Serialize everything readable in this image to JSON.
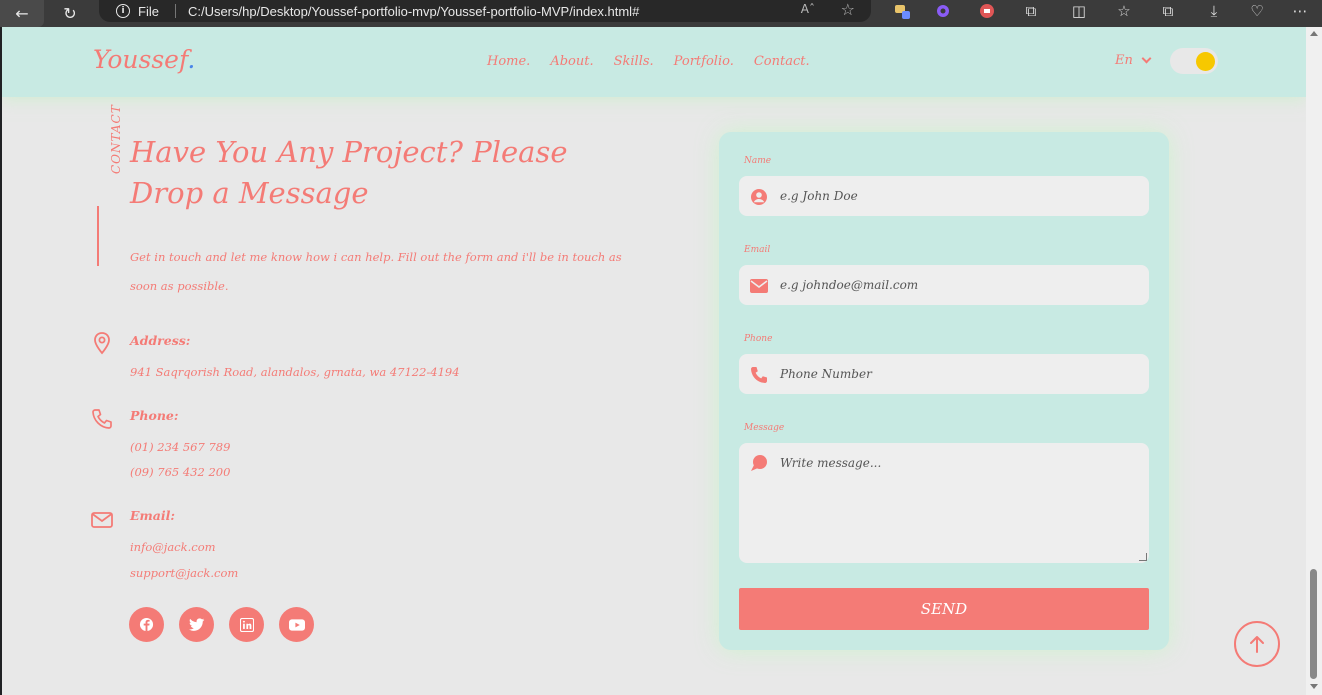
{
  "browser": {
    "file_label": "File",
    "url": "C:/Users/hp/Desktop/Youssef-portfolio-mvp/Youssef-portfolio-MVP/index.html#",
    "read_aloud": "Aˆ"
  },
  "header": {
    "logo": "Youssef",
    "logo_dot": ".",
    "nav": [
      "Home.",
      "About.",
      "Skills.",
      "Portfolio.",
      "Contact."
    ],
    "language": "En"
  },
  "contact": {
    "section_label": "CONTACT",
    "title": "Have You Any Project? Please Drop a Message",
    "description": "Get in touch and let me know how i can help. Fill out the form and i'll be in touch as soon as possible.",
    "address_label": "Address:",
    "address": "941 Saqrqorish Road, alandalos, grnata, wa 47122-4194",
    "phone_label": "Phone:",
    "phones": [
      "(01) 234 567 789",
      "(09) 765 432 200"
    ],
    "email_label": "Email:",
    "emails": [
      "info@jack.com",
      "support@jack.com"
    ]
  },
  "form": {
    "name_label": "Name",
    "name_placeholder": "e.g John Doe",
    "email_label": "Email",
    "email_placeholder": "e.g johndoe@mail.com",
    "phone_label": "Phone",
    "phone_placeholder": "Phone Number",
    "message_label": "Message",
    "message_placeholder": "Write message...",
    "send_label": "SEND"
  },
  "colors": {
    "accent": "#f47b76",
    "header_bg": "#c8eae3",
    "page_bg": "#e8e8e8",
    "toggle_knob": "#f7c800"
  }
}
